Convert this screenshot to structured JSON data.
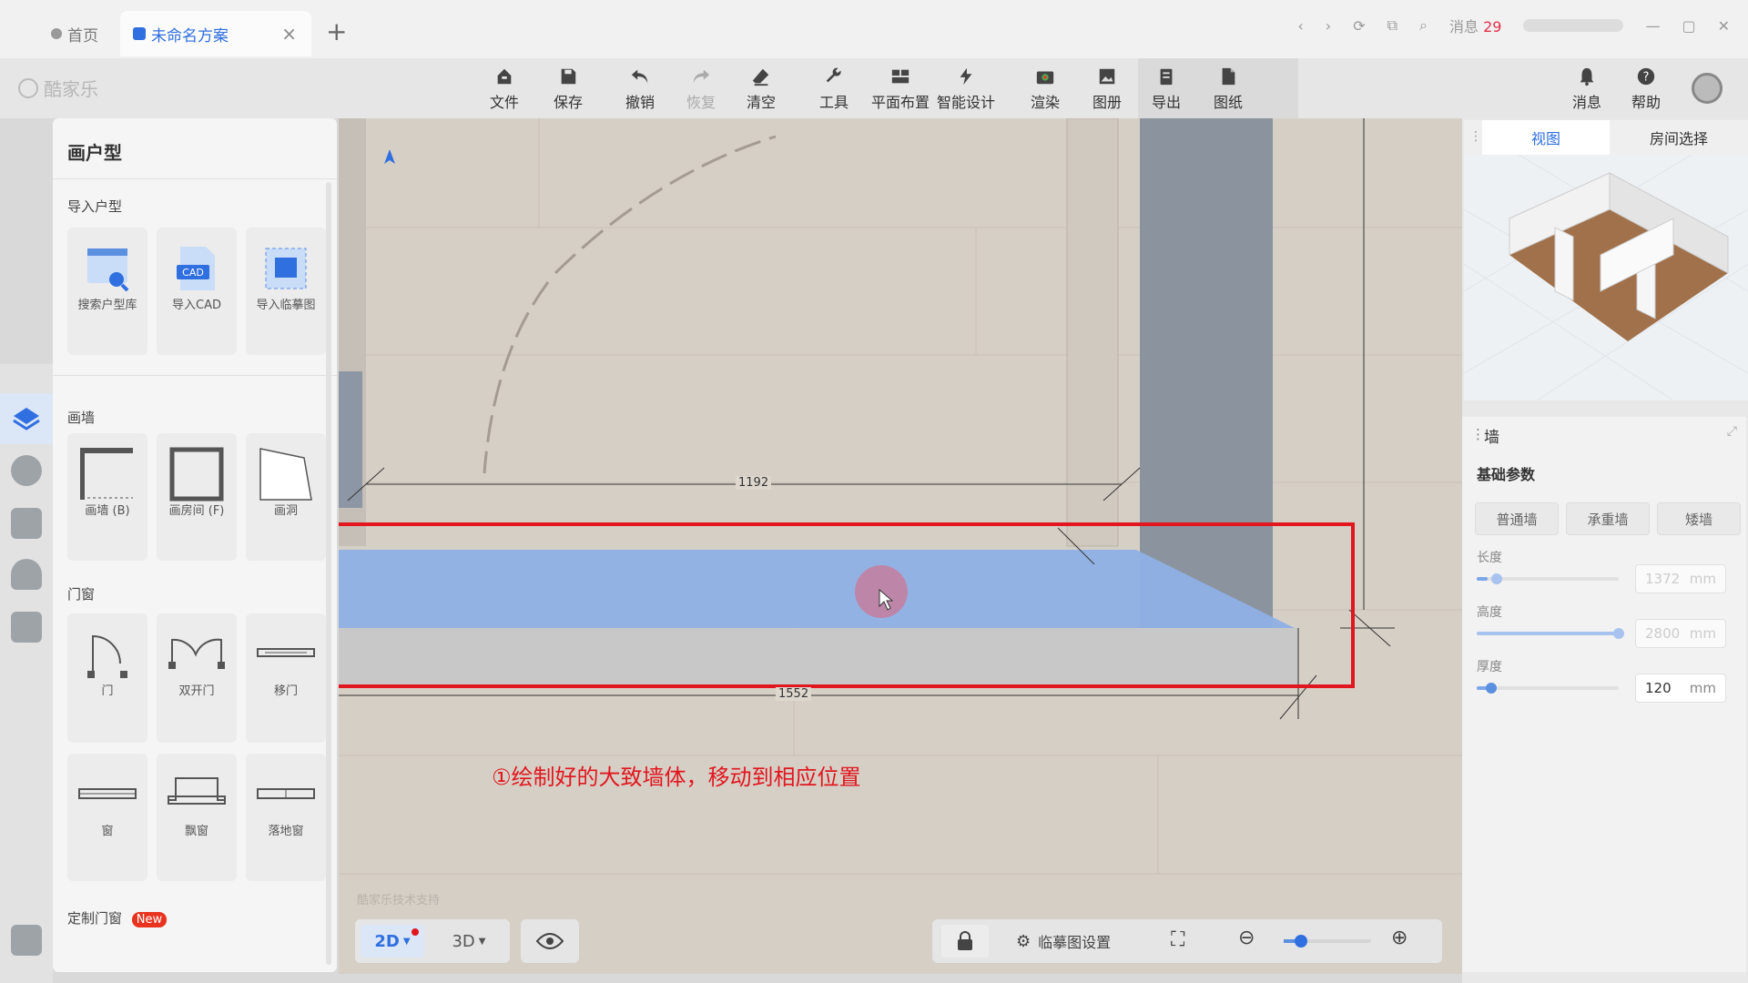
{
  "tabs": {
    "home": "首页",
    "plan": "未命名方案",
    "close": "×",
    "add": "+"
  },
  "top_right": {
    "messages_label": "消息",
    "messages_count": "29"
  },
  "brand": {
    "logo_text": "酷家乐"
  },
  "toolbar": {
    "items": [
      {
        "label": "文件",
        "icon": "house-icon"
      },
      {
        "label": "保存",
        "icon": "save-icon"
      },
      {
        "label": "撤销",
        "icon": "undo-icon"
      },
      {
        "label": "恢复",
        "icon": "redo-icon"
      },
      {
        "label": "清空",
        "icon": "eraser-icon"
      },
      {
        "label": "工具",
        "icon": "wrench-icon"
      },
      {
        "label": "平面布置",
        "icon": "layout-icon"
      },
      {
        "label": "智能设计",
        "icon": "lightning-icon"
      },
      {
        "label": "渲染",
        "icon": "camera-icon"
      },
      {
        "label": "图册",
        "icon": "image-icon"
      },
      {
        "label": "导出",
        "icon": "export-icon"
      },
      {
        "label": "图纸",
        "icon": "document-icon"
      }
    ],
    "right": [
      {
        "label": "消息",
        "icon": "bell-icon"
      },
      {
        "label": "帮助",
        "icon": "help-icon"
      }
    ]
  },
  "left_panel": {
    "title": "画户型",
    "import": {
      "heading": "导入户型",
      "items": [
        {
          "label": "搜索户型库"
        },
        {
          "label": "导入CAD",
          "badge": "CAD"
        },
        {
          "label": "导入临摹图"
        }
      ]
    },
    "draw_wall": {
      "heading": "画墙",
      "items": [
        {
          "label": "画墙 (B)"
        },
        {
          "label": "画房间 (F)"
        },
        {
          "label": "画洞"
        }
      ]
    },
    "doors": {
      "heading": "门窗",
      "items": [
        {
          "label": "门"
        },
        {
          "label": "双开门"
        },
        {
          "label": "移门"
        },
        {
          "label": "窗"
        },
        {
          "label": "飘窗"
        },
        {
          "label": "落地窗"
        }
      ]
    },
    "custom": {
      "heading": "定制门窗",
      "badge": "New"
    }
  },
  "right_panel": {
    "tabs": [
      "视图",
      "房间选择"
    ],
    "wall": {
      "title": "墙",
      "section": "基础参数",
      "types": [
        "普通墙",
        "承重墙",
        "矮墙"
      ],
      "params": [
        {
          "label": "长度",
          "value": "1372",
          "unit": "mm",
          "enabled": false,
          "level": 0.1
        },
        {
          "label": "高度",
          "value": "2800",
          "unit": "mm",
          "enabled": false,
          "level": 1.0
        },
        {
          "label": "厚度",
          "value": "120",
          "unit": "mm",
          "enabled": true,
          "level": 0.1
        }
      ]
    }
  },
  "canvas": {
    "dim_top": "1192",
    "dim_bottom": "1552",
    "annotation": "①绘制好的大致墙体，移动到相应位置",
    "watermark": "酷家乐技术支持"
  },
  "bottom_bar": {
    "view_2d": "2D",
    "view_3d": "3D",
    "trace_settings": "临摹图设置"
  },
  "colors": {
    "accent": "#2f6fe0",
    "selection_highlight": "#e1161e",
    "wall_selected": "#8fb0e6"
  }
}
